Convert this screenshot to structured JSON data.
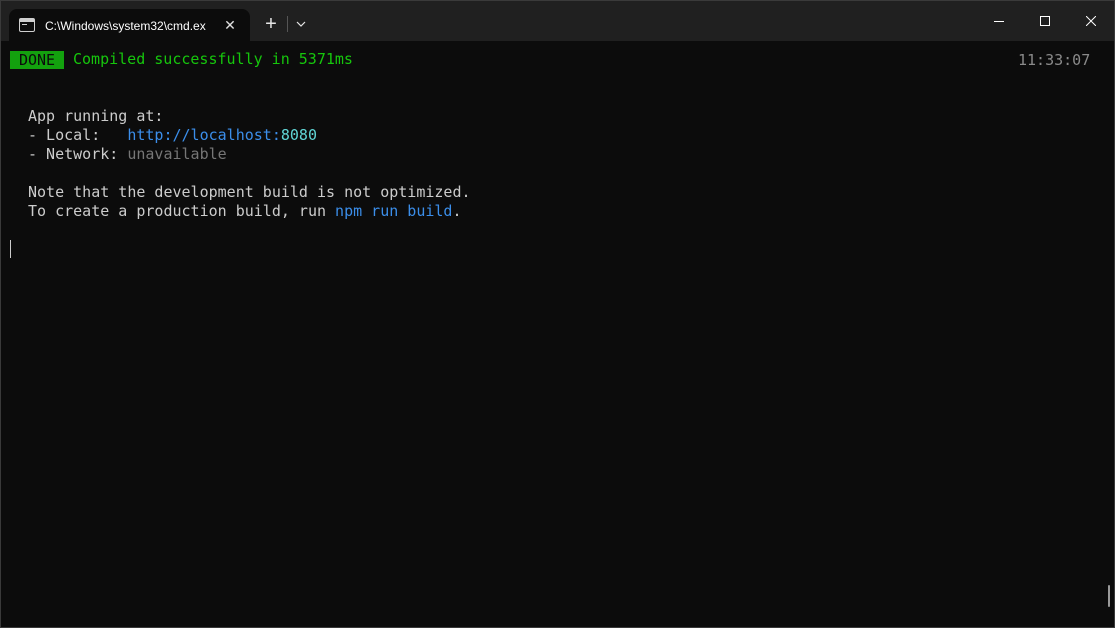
{
  "window": {
    "tab_title": "C:\\Windows\\system32\\cmd.ex",
    "tab_close": "✕",
    "new_tab": "+"
  },
  "terminal": {
    "badge": "DONE",
    "compiled_msg": "Compiled successfully in 5371ms",
    "timestamp": "11:33:07",
    "app_running": "App running at:",
    "local_label": "- Local:   ",
    "local_url_base": "http://localhost:",
    "local_url_port": "8080",
    "network_label": "- Network: ",
    "network_value": "unavailable",
    "note_line": "Note that the development build is not optimized.",
    "prod_prefix": "To create a production build, run ",
    "prod_command": "npm run build",
    "prod_suffix": "."
  },
  "colors": {
    "background": "#0c0c0c",
    "titlebar": "#202020",
    "badge_bg": "#13a10e",
    "success_text": "#16c60c",
    "link": "#3b8eea",
    "port": "#61d6d6",
    "muted": "#767676"
  },
  "icons": [
    "terminal-icon",
    "close-icon",
    "plus-icon",
    "chevron-down-icon",
    "minimize-icon",
    "maximize-icon",
    "window-close-icon"
  ]
}
